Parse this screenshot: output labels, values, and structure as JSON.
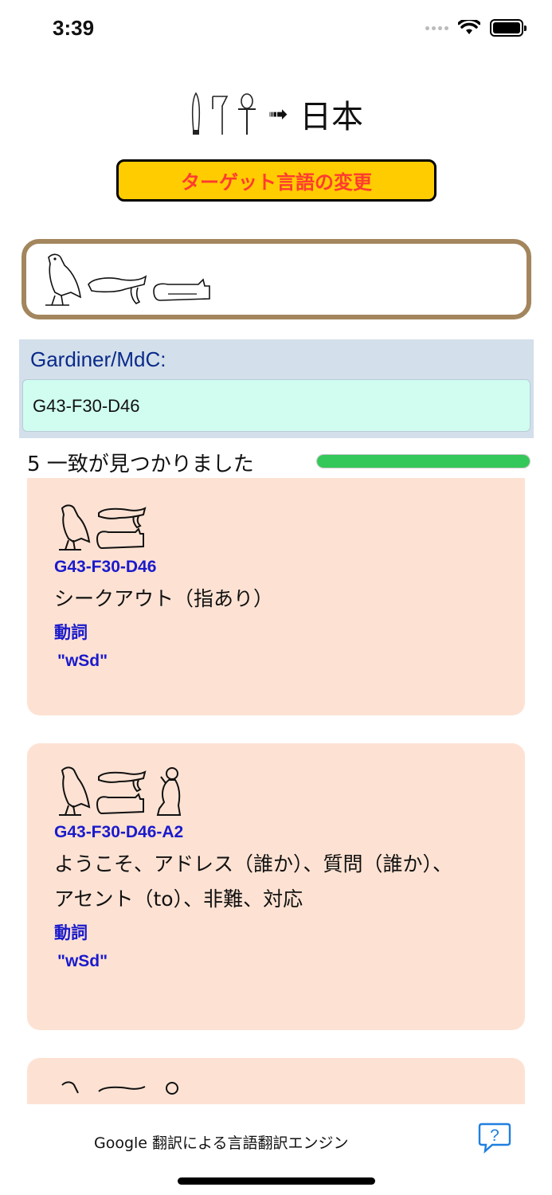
{
  "status": {
    "time": "3:39"
  },
  "header": {
    "arrow": "➟",
    "language": "日本"
  },
  "change_button": {
    "label": "ターゲット言語の変更"
  },
  "mdc": {
    "label": "Gardiner/MdC:",
    "value": "G43-F30-D46"
  },
  "matches": {
    "text": "5 一致が見つかりました",
    "progress": 1.0
  },
  "results": [
    {
      "code": "G43-F30-D46",
      "meaning": "シークアウト（指あり）",
      "pos": "動詞",
      "translit": "\"wSd\""
    },
    {
      "code": "G43-F30-D46-A2",
      "meaning": "ようこそ、アドレス（誰か）、質問（誰か）、アセント（to）、非難、対応",
      "pos": "動詞",
      "translit": "\"wSd\""
    }
  ],
  "footer": {
    "text": "Google 翻訳による言語翻訳エンジン"
  },
  "colors": {
    "accent_yellow": "#ffcc00",
    "button_text": "#ff3b30",
    "code_blue": "#1a1acc",
    "card_bg": "#fde2d3",
    "progress_green": "#34c759"
  }
}
